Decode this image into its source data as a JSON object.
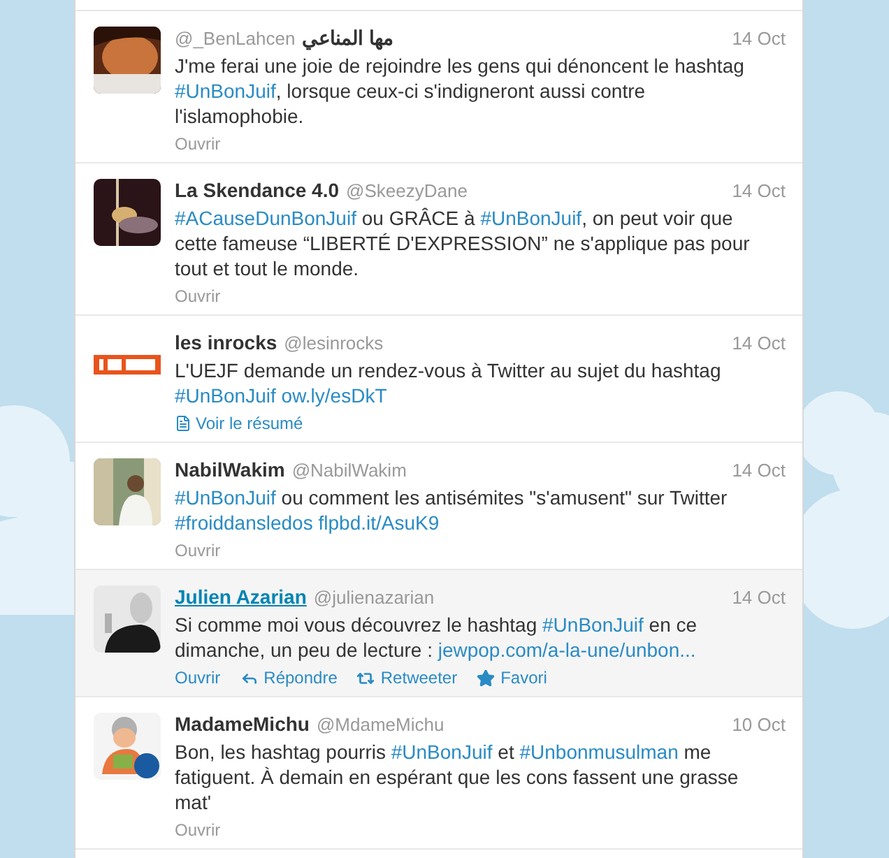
{
  "tweets": [
    {
      "name": "مها المناعي",
      "handle": "@_BenLahcen",
      "name_after_handle": true,
      "date": "14 Oct",
      "hovered": false,
      "segments": [
        {
          "kind": "text",
          "text": "J'me ferai une joie de rejoindre les gens qui dénoncent le hashtag "
        },
        {
          "kind": "link",
          "text": "#UnBonJuif"
        },
        {
          "kind": "text",
          "text": ", lorsque ceux-ci s'indigneront aussi contre l'islamophobie."
        }
      ],
      "footer": {
        "kind": "open",
        "label": "Ouvrir"
      }
    },
    {
      "name": "La Skendance 4.0",
      "handle": "@SkeezyDane",
      "name_after_handle": false,
      "date": "14 Oct",
      "hovered": false,
      "segments": [
        {
          "kind": "link",
          "text": "#ACauseDunBonJuif"
        },
        {
          "kind": "text",
          "text": " ou GRÂCE à "
        },
        {
          "kind": "link",
          "text": "#UnBonJuif"
        },
        {
          "kind": "text",
          "text": ", on peut voir que cette fameuse “LIBERTÉ D'EXPRESSION” ne s'applique pas pour tout et tout le monde."
        }
      ],
      "footer": {
        "kind": "open",
        "label": "Ouvrir"
      }
    },
    {
      "name": "les inrocks",
      "handle": "@lesinrocks",
      "name_after_handle": false,
      "date": "14 Oct",
      "hovered": false,
      "segments": [
        {
          "kind": "text",
          "text": "L'UEJF demande un rendez-vous à Twitter au sujet du hashtag "
        },
        {
          "kind": "link",
          "text": "#UnBonJuif"
        },
        {
          "kind": "link",
          "text": "ow.ly/esDkT"
        }
      ],
      "footer": {
        "kind": "summary",
        "label": "Voir le résumé"
      }
    },
    {
      "name": "NabilWakim",
      "handle": "@NabilWakim",
      "name_after_handle": false,
      "date": "14 Oct",
      "hovered": false,
      "segments": [
        {
          "kind": "link",
          "text": "#UnBonJuif"
        },
        {
          "kind": "text",
          "text": " ou comment les antisémites \"s'amusent\" sur Twitter "
        },
        {
          "kind": "link",
          "text": "#froiddansledos"
        },
        {
          "kind": "link",
          "text": "flpbd.it/AsuK9"
        }
      ],
      "footer": {
        "kind": "open",
        "label": "Ouvrir"
      }
    },
    {
      "name": "Julien Azarian",
      "handle": "@julienazarian",
      "name_after_handle": false,
      "date": "14 Oct",
      "hovered": true,
      "segments": [
        {
          "kind": "text",
          "text": "Si comme moi vous découvrez le hashtag "
        },
        {
          "kind": "link",
          "text": "#UnBonJuif"
        },
        {
          "kind": "text",
          "text": " en ce dimanche, un peu de lecture : "
        },
        {
          "kind": "link",
          "text": "jewpop.com/a-la-une/unbon..."
        }
      ],
      "footer": {
        "kind": "open",
        "label": "Ouvrir"
      },
      "actions": [
        {
          "kind": "reply",
          "label": "Répondre"
        },
        {
          "kind": "retweet",
          "label": "Retweeter"
        },
        {
          "kind": "favorite",
          "label": "Favori"
        }
      ]
    },
    {
      "name": "MadameMichu",
      "handle": "@MdameMichu",
      "name_after_handle": false,
      "date": "10 Oct",
      "hovered": false,
      "segments": [
        {
          "kind": "text",
          "text": "Bon, les hashtag pourris "
        },
        {
          "kind": "link",
          "text": "#UnBonJuif"
        },
        {
          "kind": "text",
          "text": " et "
        },
        {
          "kind": "link",
          "text": "#Unbonmusulman"
        },
        {
          "kind": "text",
          "text": " me fatiguent. À demain en espérant que les cons fassent une grasse mat'"
        }
      ],
      "footer": {
        "kind": "open",
        "label": "Ouvrir"
      }
    }
  ]
}
